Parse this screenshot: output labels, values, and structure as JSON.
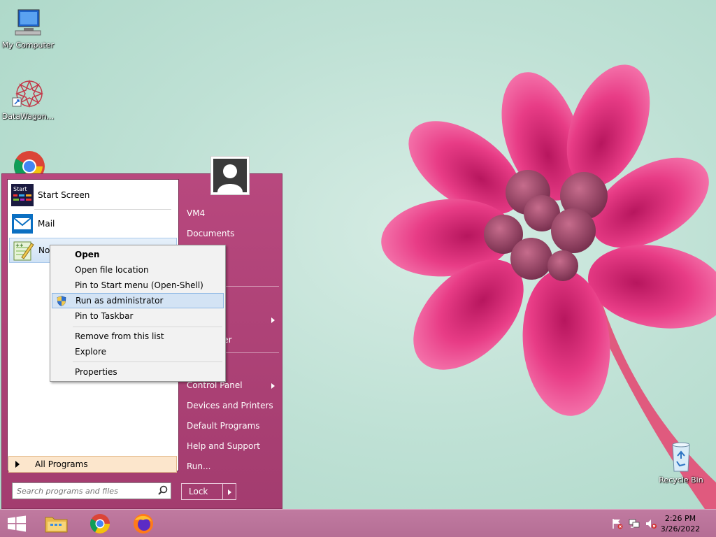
{
  "desktop": {
    "icons": [
      {
        "label": "My Computer",
        "icon": "computer-icon"
      },
      {
        "label": "DataWagon...",
        "icon": "datawagon-icon"
      },
      {
        "label": "",
        "icon": "chrome-icon"
      },
      {
        "label": "Recycle Bin",
        "icon": "recycle-bin-icon"
      }
    ]
  },
  "start_menu": {
    "programs": [
      {
        "label": "Start Screen",
        "icon": "start-screen-icon",
        "icon_text": "Start"
      },
      {
        "label": "Mail",
        "icon": "mail-icon"
      },
      {
        "label": "Not",
        "icon": "notepadpp-icon"
      }
    ],
    "all_programs": "All Programs",
    "search_placeholder": "Search programs and files",
    "right_items": [
      {
        "label": "VM4",
        "arrow": false
      },
      {
        "label": "Documents",
        "arrow": false
      },
      {
        "label": "ns",
        "arrow": true
      },
      {
        "label": "uter",
        "arrow": false
      },
      {
        "label": "Control Panel",
        "arrow": true
      },
      {
        "label": "Devices and Printers",
        "arrow": false
      },
      {
        "label": "Default Programs",
        "arrow": false
      },
      {
        "label": "Help and Support",
        "arrow": false
      },
      {
        "label": "Run...",
        "arrow": false
      }
    ],
    "lock_label": "Lock"
  },
  "context_menu": {
    "items": [
      {
        "label": "Open",
        "bold": true
      },
      {
        "label": "Open file location"
      },
      {
        "label": "Pin to Start menu (Open-Shell)"
      },
      {
        "label": "Run as administrator",
        "highlighted": true,
        "icon": "uac-shield-icon"
      },
      {
        "label": "Pin to Taskbar"
      },
      {
        "label": "Remove from this list"
      },
      {
        "label": "Explore"
      },
      {
        "label": "Properties"
      }
    ]
  },
  "taskbar": {
    "buttons": [
      "start-button",
      "file-explorer",
      "chrome",
      "firefox"
    ],
    "clock_time": "2:26 PM",
    "clock_date": "3/26/2022"
  },
  "colors": {
    "start_menu_bg": "#a33c6f",
    "taskbar_bg": "#b56e95",
    "context_highlight": "#d3e3f4",
    "all_programs_bg": "#fce6cc"
  }
}
